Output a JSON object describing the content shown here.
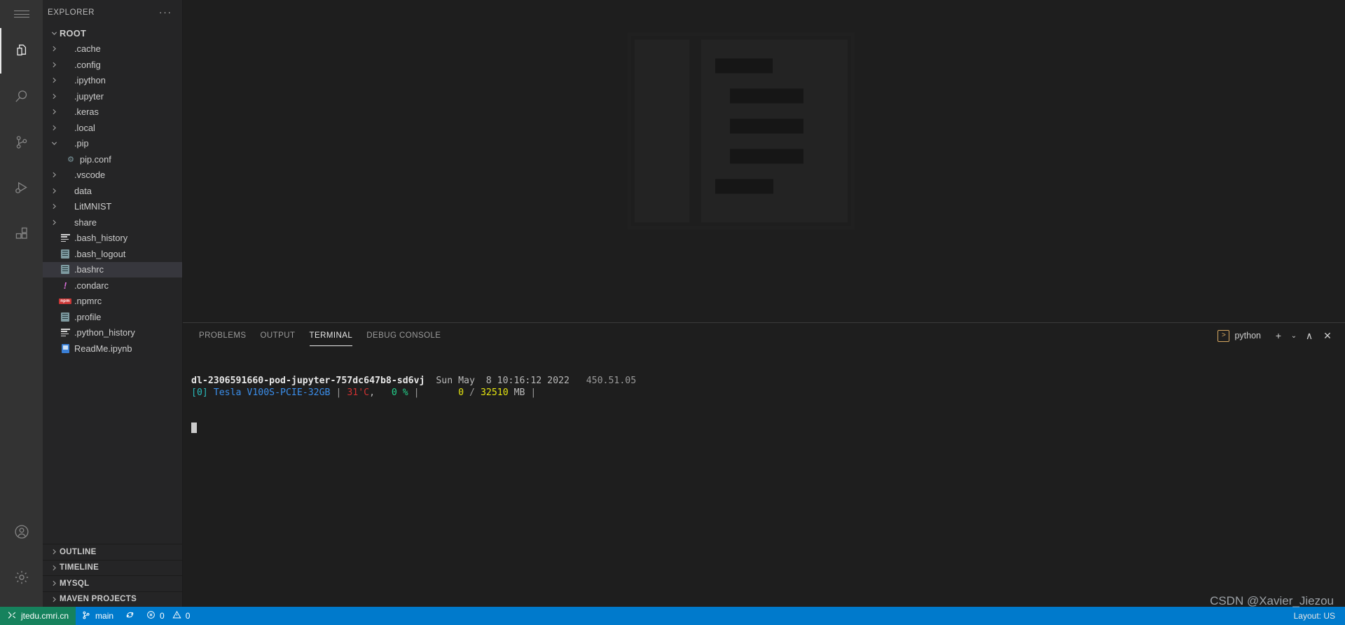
{
  "activity_bar": {
    "menu_label": "Menu",
    "items": [
      {
        "name": "explorer",
        "title": "Explorer",
        "active": true
      },
      {
        "name": "search",
        "title": "Search",
        "active": false
      },
      {
        "name": "source-control",
        "title": "Source Control",
        "active": false
      },
      {
        "name": "run-and-debug",
        "title": "Run and Debug",
        "active": false
      },
      {
        "name": "extensions",
        "title": "Extensions",
        "active": false
      }
    ],
    "bottom_items": [
      {
        "name": "accounts",
        "title": "Accounts"
      },
      {
        "name": "settings",
        "title": "Manage"
      }
    ]
  },
  "sidebar": {
    "title": "EXPLORER",
    "more_actions": "···",
    "root": {
      "label": "ROOT",
      "expanded": true
    },
    "tree": [
      {
        "label": ".cache",
        "type": "folder",
        "expanded": false,
        "depth": 1
      },
      {
        "label": ".config",
        "type": "folder",
        "expanded": false,
        "depth": 1
      },
      {
        "label": ".ipython",
        "type": "folder",
        "expanded": false,
        "depth": 1
      },
      {
        "label": ".jupyter",
        "type": "folder",
        "expanded": false,
        "depth": 1
      },
      {
        "label": ".keras",
        "type": "folder",
        "expanded": false,
        "depth": 1
      },
      {
        "label": ".local",
        "type": "folder",
        "expanded": false,
        "depth": 1
      },
      {
        "label": ".pip",
        "type": "folder",
        "expanded": true,
        "depth": 1
      },
      {
        "label": "pip.conf",
        "type": "file",
        "icon": "gear-icon",
        "depth": 2
      },
      {
        "label": ".vscode",
        "type": "folder",
        "expanded": false,
        "depth": 1
      },
      {
        "label": "data",
        "type": "folder",
        "expanded": false,
        "depth": 1
      },
      {
        "label": "LitMNIST",
        "type": "folder",
        "expanded": false,
        "depth": 1
      },
      {
        "label": "share",
        "type": "folder",
        "expanded": false,
        "depth": 1
      },
      {
        "label": ".bash_history",
        "type": "file",
        "icon": "lines-icon",
        "depth": 1
      },
      {
        "label": ".bash_logout",
        "type": "file",
        "icon": "document-icon",
        "depth": 1
      },
      {
        "label": ".bashrc",
        "type": "file",
        "icon": "document-icon",
        "depth": 1,
        "selected": true
      },
      {
        "label": ".condarc",
        "type": "file",
        "icon": "exclamation-icon",
        "depth": 1
      },
      {
        "label": ".npmrc",
        "type": "file",
        "icon": "npm-icon",
        "depth": 1
      },
      {
        "label": ".profile",
        "type": "file",
        "icon": "document-icon",
        "depth": 1
      },
      {
        "label": ".python_history",
        "type": "file",
        "icon": "lines-icon",
        "depth": 1
      },
      {
        "label": "ReadMe.ipynb",
        "type": "file",
        "icon": "notebook-icon",
        "depth": 1
      }
    ],
    "sections": [
      {
        "label": "OUTLINE",
        "expanded": false
      },
      {
        "label": "TIMELINE",
        "expanded": false
      },
      {
        "label": "MYSQL",
        "expanded": false
      },
      {
        "label": "MAVEN PROJECTS",
        "expanded": false
      }
    ]
  },
  "editor": {
    "watermark_alt": "empty-editor-placeholder"
  },
  "panel": {
    "tabs": [
      {
        "label": "PROBLEMS",
        "active": false
      },
      {
        "label": "OUTPUT",
        "active": false
      },
      {
        "label": "TERMINAL",
        "active": true
      },
      {
        "label": "DEBUG CONSOLE",
        "active": false
      }
    ],
    "active_terminal": "python",
    "actions": {
      "new_terminal": "+",
      "split_dropdown": "⌄",
      "maximize": "∧",
      "close": "✕"
    },
    "terminal_lines": [
      {
        "segments": [
          {
            "text": "dl-2306591660-pod-jupyter-757dc647b8-sd6vj",
            "style": "host"
          },
          {
            "text": "  Sun May  8 10:16:12 2022   ",
            "style": "gray"
          },
          {
            "text": "450.51.05",
            "style": "dim"
          }
        ]
      },
      {
        "segments": [
          {
            "text": "[0]",
            "style": "cyan"
          },
          {
            "text": " Tesla V100S-PCIE-32GB ",
            "style": "blue"
          },
          {
            "text": "|",
            "style": "sep"
          },
          {
            "text": " 31'C",
            "style": "red"
          },
          {
            "text": ",  ",
            "style": "gray"
          },
          {
            "text": " 0 %",
            "style": "green"
          },
          {
            "text": " |   ",
            "style": "sep"
          },
          {
            "text": "    0",
            "style": "yellow"
          },
          {
            "text": " / ",
            "style": "sep"
          },
          {
            "text": "32510",
            "style": "yellow"
          },
          {
            "text": " MB",
            "style": "gray"
          },
          {
            "text": " |",
            "style": "sep"
          }
        ]
      }
    ]
  },
  "status_bar": {
    "remote_host": "jtedu.cmri.cn",
    "branch": "main",
    "sync_icon": "sync-icon",
    "errors": "0",
    "warnings": "0",
    "right_text": "Layout: US"
  },
  "credit": "CSDN @Xavier_Jiezou",
  "colors": {
    "activity_bar_bg": "#333333",
    "sidebar_bg": "#252526",
    "editor_bg": "#1e1e1e",
    "status_bar_bg": "#007acc",
    "remote_bg": "#16825d",
    "selection_bg": "#37373d",
    "terminal_cyan": "#29b8b8",
    "terminal_blue": "#3b8eea",
    "terminal_red": "#cd3131",
    "terminal_green": "#23d18b",
    "terminal_yellow": "#e5e510"
  }
}
